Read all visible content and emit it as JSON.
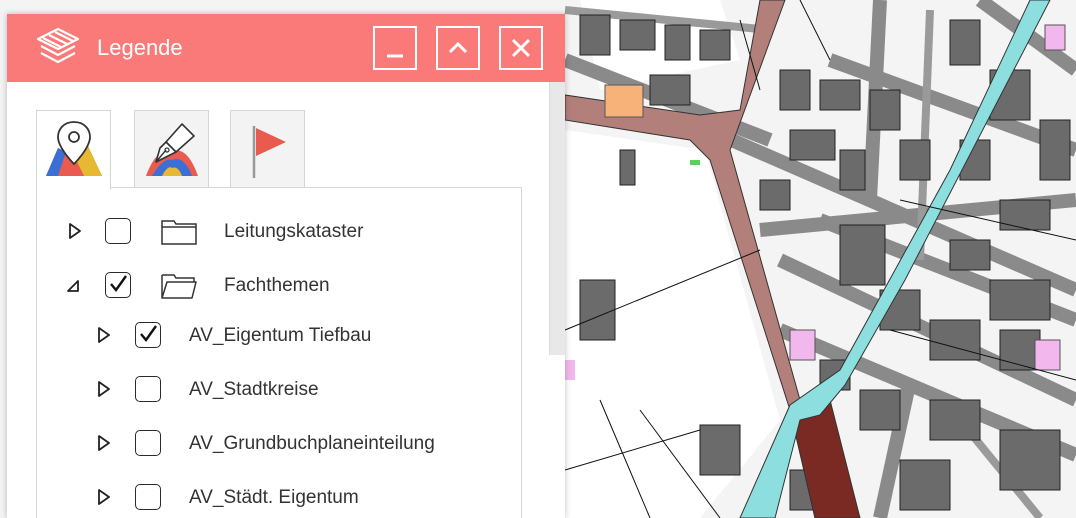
{
  "panel": {
    "title": "Legende",
    "title_icon": "layers-icon",
    "buttons": {
      "minimize": "minimize-icon",
      "collapse": "chevron-up-icon",
      "close": "close-icon"
    },
    "tabs": [
      {
        "icon": "map-pin-icon",
        "active": true
      },
      {
        "icon": "pen-nib-icon",
        "active": false
      },
      {
        "icon": "flag-icon",
        "active": false
      }
    ]
  },
  "tree": [
    {
      "label": "Leitungskataster",
      "expanded": false,
      "checked": false,
      "folder": true,
      "level": 0
    },
    {
      "label": "Fachthemen",
      "expanded": true,
      "checked": true,
      "folder": true,
      "level": 0
    },
    {
      "label": "AV_Eigentum Tiefbau",
      "expanded": false,
      "checked": true,
      "folder": false,
      "level": 1
    },
    {
      "label": "AV_Stadtkreise",
      "expanded": false,
      "checked": false,
      "folder": false,
      "level": 1
    },
    {
      "label": "AV_Grundbuchplaneinteilung",
      "expanded": false,
      "checked": false,
      "folder": false,
      "level": 1
    },
    {
      "label": "AV_Städt. Eigentum",
      "expanded": false,
      "checked": false,
      "folder": false,
      "level": 1
    }
  ],
  "colors": {
    "titlebar": "#f97a78",
    "road_brown": "#b37f7a",
    "road_dark": "#7a2a22",
    "canal_cyan": "#8ddede",
    "building": "#6b6b6b",
    "highlight_pink": "#f2b8ee",
    "highlight_orange": "#f7b27a"
  }
}
